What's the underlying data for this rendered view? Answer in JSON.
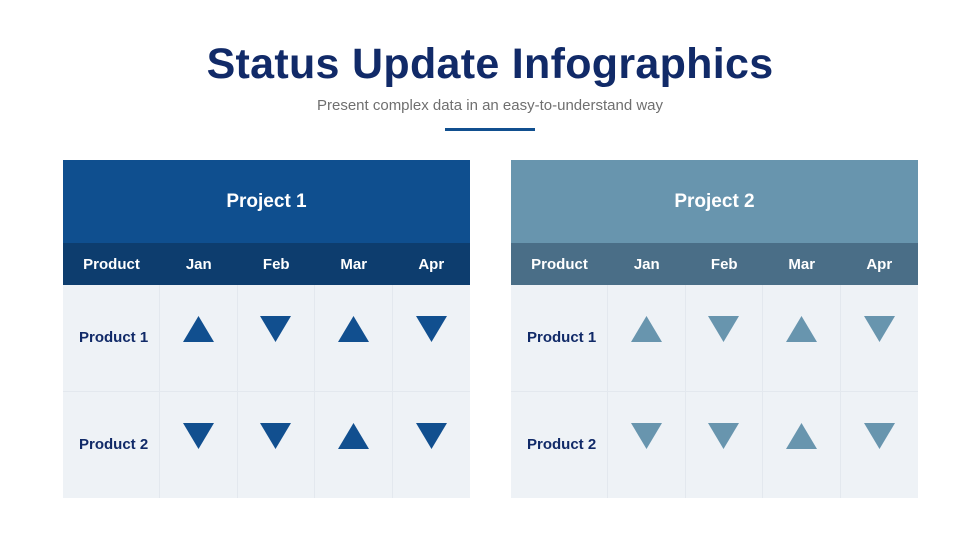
{
  "header": {
    "title": "Status Update Infographics",
    "subtitle": "Present complex data in an easy-to-understand way",
    "accent_color": "#114f8f"
  },
  "projects": [
    {
      "title": "Project 1",
      "colors": {
        "head": "#0f4f8f",
        "sub": "#0d3d6e",
        "icon": "#114f8f"
      },
      "columns": [
        "Product",
        "Jan",
        "Feb",
        "Mar",
        "Apr"
      ],
      "rows": [
        {
          "label": "Product 1",
          "status": [
            "up",
            "down",
            "up",
            "down"
          ]
        },
        {
          "label": "Product 2",
          "status": [
            "down",
            "down",
            "up",
            "down"
          ]
        }
      ]
    },
    {
      "title": "Project 2",
      "colors": {
        "head": "#6895ae",
        "sub": "#4a6e87",
        "icon": "#6895ae"
      },
      "columns": [
        "Product",
        "Jan",
        "Feb",
        "Mar",
        "Apr"
      ],
      "rows": [
        {
          "label": "Product 1",
          "status": [
            "up",
            "down",
            "up",
            "down"
          ]
        },
        {
          "label": "Product 2",
          "status": [
            "down",
            "down",
            "up",
            "down"
          ]
        }
      ]
    }
  ],
  "icons": {
    "up": "triangle-up-icon",
    "down": "triangle-down-icon"
  }
}
